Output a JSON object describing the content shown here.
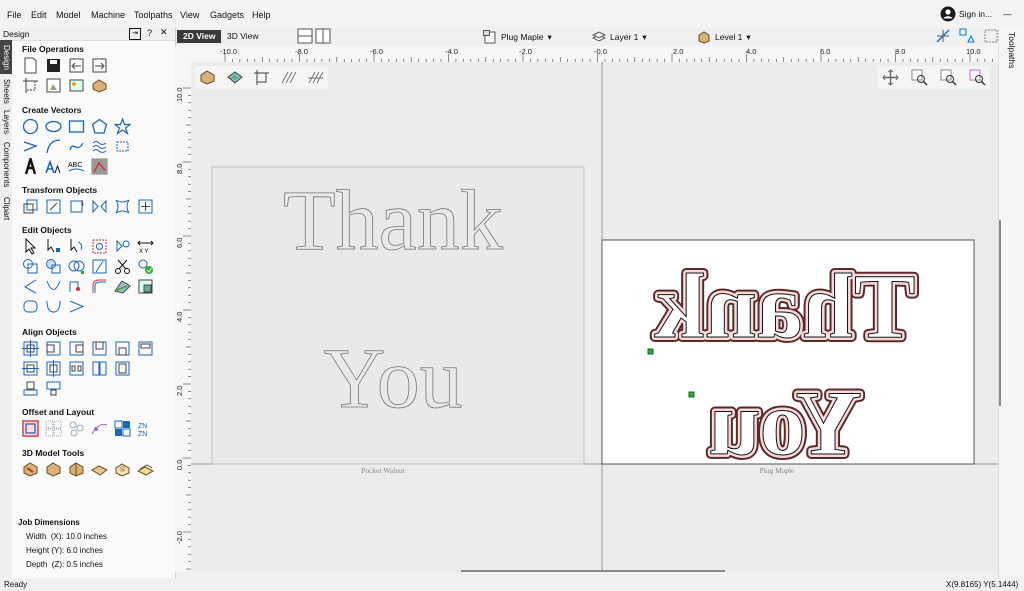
{
  "menu": [
    "File",
    "Edit",
    "Model",
    "Machine",
    "Toolpaths",
    "View",
    "Gadgets",
    "Help"
  ],
  "account": {
    "label": "Sign in..."
  },
  "view_tabs": {
    "tab_2d": "2D View",
    "tab_3d": "3D View"
  },
  "toolbar": {
    "component": "Plug Maple",
    "layer": "Layer 1",
    "level": "Level 1"
  },
  "left_panel": {
    "title": "Design",
    "help_glyph": "?",
    "tabs": [
      "Design",
      "Sheets",
      "Layers",
      "Components",
      "Clipart"
    ],
    "sections": {
      "file": "File Operations",
      "create": "Create Vectors",
      "transform": "Transform Objects",
      "edit": "Edit Objects",
      "align": "Align Objects",
      "offset": "Offset and Layout",
      "model3d": "3D Model Tools"
    },
    "job": {
      "title": "Job Dimensions",
      "width": "Width  (X): 10.0 inches",
      "height": "Height (Y): 6.0 inches",
      "depth": "Depth  (Z): 0.5 inches"
    }
  },
  "right_panel": {
    "tab": "Toolpaths"
  },
  "ruler": {
    "top": [
      "-10.0",
      "-8.0",
      "-6.0",
      "-4.0",
      "-2.0",
      "-0.0",
      "2.0",
      "4.0",
      "6.0",
      "8.0",
      "10.0"
    ],
    "left": [
      "10.0",
      "8.0",
      "6.0",
      "4.0",
      "2.0",
      "0.0",
      "-2.0"
    ]
  },
  "canvas": {
    "left_sheet_label": "Pocket Walnut",
    "right_sheet_label": "Plug Maple",
    "text_line1": "Thank",
    "text_line2": "You"
  },
  "status": {
    "left": "Ready",
    "coords": "X(9.8165) Y(5.1444)"
  },
  "colors": {
    "accent": "#0078d4",
    "toolpath": "#c1686d",
    "toolpath_fill": "#f3d2d2",
    "dark_tab": "#3a3a3a"
  }
}
